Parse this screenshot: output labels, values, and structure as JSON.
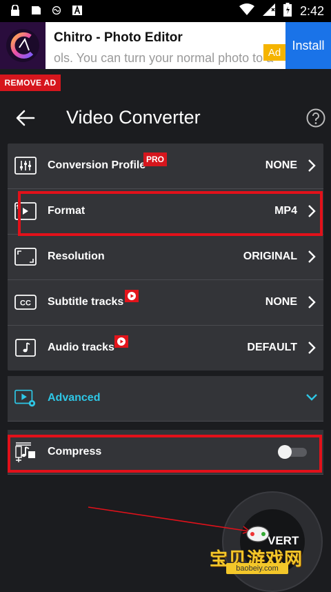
{
  "status_bar": {
    "time": "2:42",
    "left_icons": [
      "lock-icon",
      "sim-icon",
      "app-icon",
      "font-icon"
    ],
    "right_icons": [
      "wifi-icon",
      "signal-icon",
      "battery-icon"
    ]
  },
  "ad": {
    "title": "Chitro - Photo Editor",
    "description": "ols. You can turn your normal photo to a",
    "tag": "Ad",
    "install_label": "Install",
    "remove_ad_label": "REMOVE AD"
  },
  "header": {
    "title": "Video Converter",
    "back_icon": "back-arrow-icon",
    "help_icon": "help-icon"
  },
  "settings": [
    {
      "name": "conversion-profile",
      "label": "Conversion Profile",
      "value": "NONE",
      "badge": "PRO",
      "icon": "sliders-icon"
    },
    {
      "name": "format",
      "label": "Format",
      "value": "MP4",
      "icon": "video-format-icon"
    },
    {
      "name": "resolution",
      "label": "Resolution",
      "value": "ORIGINAL",
      "icon": "resolution-icon"
    },
    {
      "name": "subtitle-tracks",
      "label": "Subtitle tracks",
      "value": "NONE",
      "icon": "cc-icon"
    },
    {
      "name": "audio-tracks",
      "label": "Audio tracks",
      "value": "DEFAULT",
      "icon": "music-note-icon"
    }
  ],
  "advanced": {
    "label": "Advanced",
    "icon": "video-settings-icon"
  },
  "compress": {
    "label": "Compress",
    "enabled": false,
    "icon": "compress-icon"
  },
  "convert_button": {
    "label": "VERT"
  },
  "watermark": {
    "text": "宝贝游戏网",
    "url": "baobeiy.com"
  },
  "colors": {
    "accent": "#2ec7e6",
    "highlight": "#e2111a",
    "badge": "#d6161d",
    "background": "#1b1c1f",
    "card": "#333438"
  }
}
